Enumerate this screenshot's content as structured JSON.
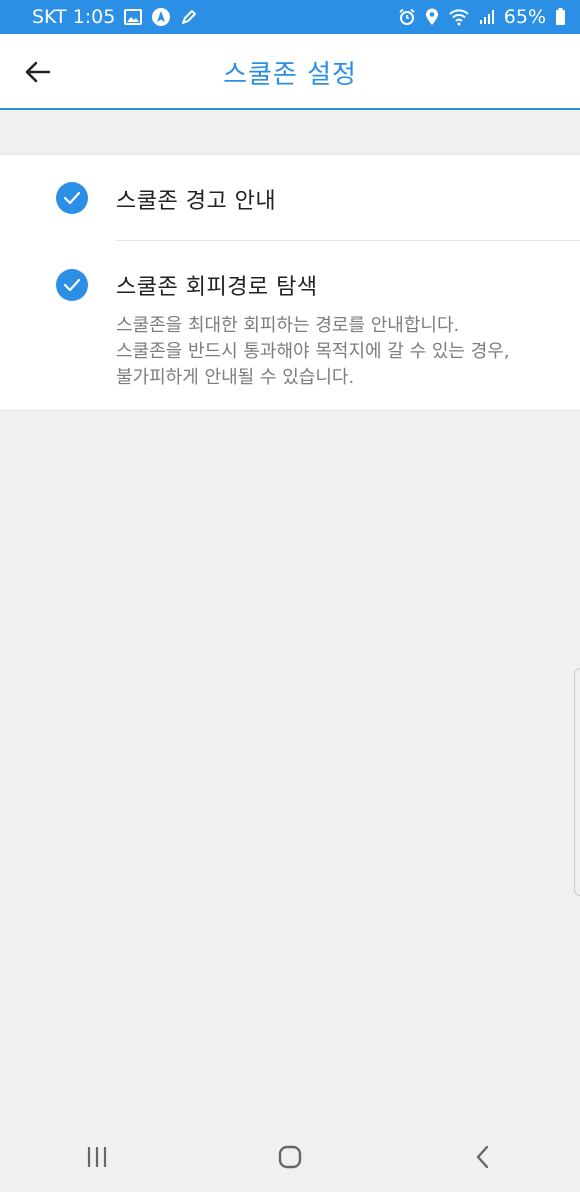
{
  "status_bar": {
    "carrier_time": "SKT 1:05",
    "battery": "65%"
  },
  "header": {
    "title": "스쿨존 설정"
  },
  "settings": [
    {
      "title": "스쿨존 경고 안내",
      "checked": true
    },
    {
      "title": "스쿨존 회피경로 탐색",
      "checked": true,
      "description": [
        "스쿨존을 최대한 회피하는 경로를 안내합니다.",
        "스쿨존을 반드시 통과해야 목적지에 갈 수 있는 경우,",
        "불가피하게 안내될 수 있습니다."
      ]
    }
  ],
  "colors": {
    "accent": "#2b8fe6",
    "background": "#eef0f1"
  },
  "icons": {
    "status_left": [
      "gallery-icon",
      "navigation-icon",
      "edit-icon"
    ],
    "status_right": [
      "alarm-icon",
      "location-icon",
      "wifi-icon",
      "signal-icon",
      "battery-icon"
    ],
    "nav": [
      "recent-apps-icon",
      "home-icon",
      "back-nav-icon"
    ]
  }
}
